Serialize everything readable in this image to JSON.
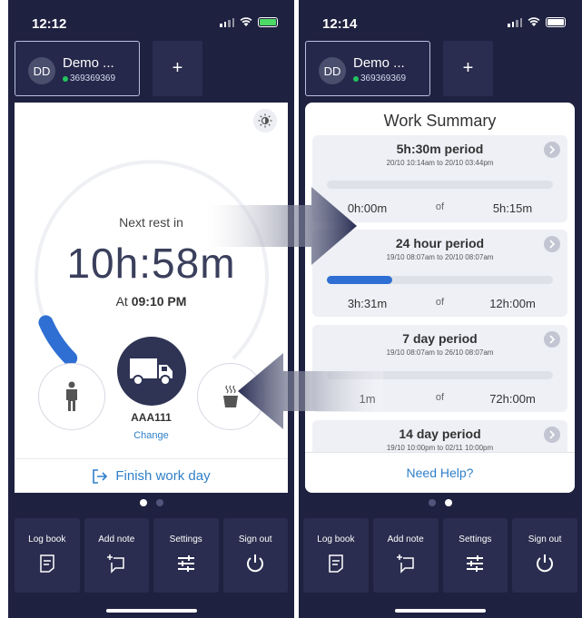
{
  "left": {
    "status": {
      "time": "12:12"
    },
    "driver": {
      "initials": "DD",
      "name": "Demo ...",
      "id": "369369369"
    },
    "add_label": "+",
    "rest": {
      "label": "Next rest in",
      "time_h": "10",
      "sep_h": "h:",
      "time_m": "58",
      "unit_m": "m",
      "at_label": "At",
      "at_time": "09:10 PM"
    },
    "vehicle": {
      "plate": "AAA111",
      "change": "Change"
    },
    "finish": "Finish work day",
    "progress_fraction": 0.08
  },
  "right": {
    "status": {
      "time": "12:14"
    },
    "driver": {
      "initials": "DD",
      "name": "Demo ...",
      "id": "369369369"
    },
    "add_label": "+",
    "summary": {
      "title": "Work Summary",
      "periods": [
        {
          "name": "5h:30m period",
          "range": "20/10 10:14am to 20/10 03:44pm",
          "used": "0h:00m",
          "of": "of",
          "limit": "5h:15m",
          "fraction": 0
        },
        {
          "name": "24 hour period",
          "range": "19/10 08:07am to 20/10 08:07am",
          "used": "3h:31m",
          "of": "of",
          "limit": "12h:00m",
          "fraction": 0.29
        },
        {
          "name": "7 day period",
          "range": "19/10 08:07am to 26/10 08:07am",
          "used": "1m",
          "of": "of",
          "limit": "72h:00m",
          "fraction": 0
        },
        {
          "name": "14 day period",
          "range": "19/10 10:00pm to 02/11 10:00pm",
          "used": "",
          "of": "",
          "limit": "",
          "fraction": 0
        }
      ],
      "help": "Need Help?"
    }
  },
  "nav": [
    {
      "label": "Log book",
      "icon": "logbook-icon"
    },
    {
      "label": "Add note",
      "icon": "add-note-icon"
    },
    {
      "label": "Settings",
      "icon": "settings-icon"
    },
    {
      "label": "Sign out",
      "icon": "power-icon"
    }
  ],
  "colors": {
    "background": "#1f2140",
    "accent": "#2f7fc9",
    "progress": "#2f6fd3",
    "battery_charging": "#4cd964"
  }
}
